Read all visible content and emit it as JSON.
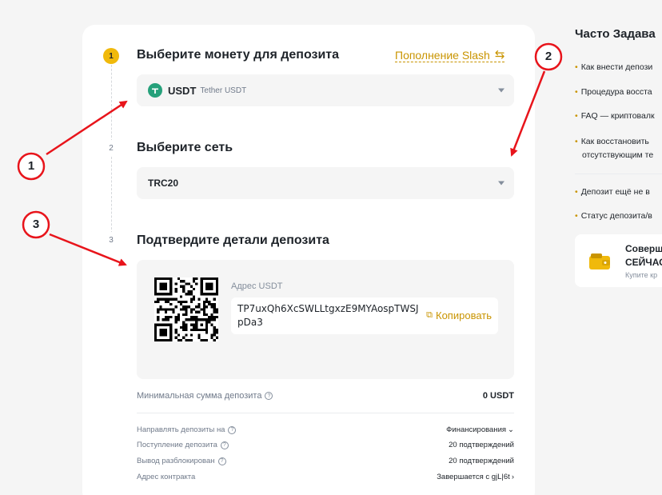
{
  "steps": [
    {
      "num": "1",
      "title": "Выберите монету для депозита"
    },
    {
      "num": "2",
      "title": "Выберите сеть"
    },
    {
      "num": "3",
      "title": "Подтвердите детали депозита"
    }
  ],
  "slash_link": {
    "label": "Пополнение Slash",
    "icon": "swap-icon"
  },
  "coin_select": {
    "symbol": "USDT",
    "name": "Tether USDT",
    "icon": "tether-icon"
  },
  "network_select": {
    "value": "TRC20"
  },
  "deposit": {
    "address_label": "Адрес USDT",
    "address": "TP7uxQh6XcSWLLtgxzE9MYAospTWSJpDa3",
    "copy_label": "Копировать"
  },
  "min_deposit": {
    "label": "Минимальная сумма депозита",
    "value": "0 USDT"
  },
  "details": [
    {
      "label": "Направлять депозиты на",
      "value": "Финансирования",
      "has_info": true,
      "suffix": "chevron-down-icon"
    },
    {
      "label": "Поступление депозита",
      "value": "20 подтверждений",
      "has_info": true,
      "suffix": ""
    },
    {
      "label": "Вывод разблокирован",
      "value": "20 подтверждений",
      "has_info": true,
      "suffix": ""
    },
    {
      "label": "Адрес контракта",
      "value": "Завершается с gjL|6t",
      "has_info": false,
      "suffix": "chevron-right-icon"
    }
  ],
  "faq": {
    "title": "Часто Задава",
    "items": [
      [
        "Как внести депози"
      ],
      [
        "Процедура восста"
      ],
      [
        "FAQ — криптовалк"
      ],
      [
        "Как восстановить",
        "отсутствующим те"
      ],
      [
        "Депозит ещё не в"
      ],
      [
        "Статус депозита/в"
      ]
    ]
  },
  "promo": {
    "line1": "Соверш",
    "line2": "СЕЙЧАС",
    "line3": "Купите кр"
  },
  "annotations": [
    {
      "label": "1",
      "color": "#e8141b"
    },
    {
      "label": "2",
      "color": "#e8141b"
    },
    {
      "label": "3",
      "color": "#e8141b"
    }
  ],
  "colors": {
    "accent": "#f0b90b",
    "link": "#c99400",
    "annotation": "#e8141b",
    "tether": "#26a17b"
  }
}
